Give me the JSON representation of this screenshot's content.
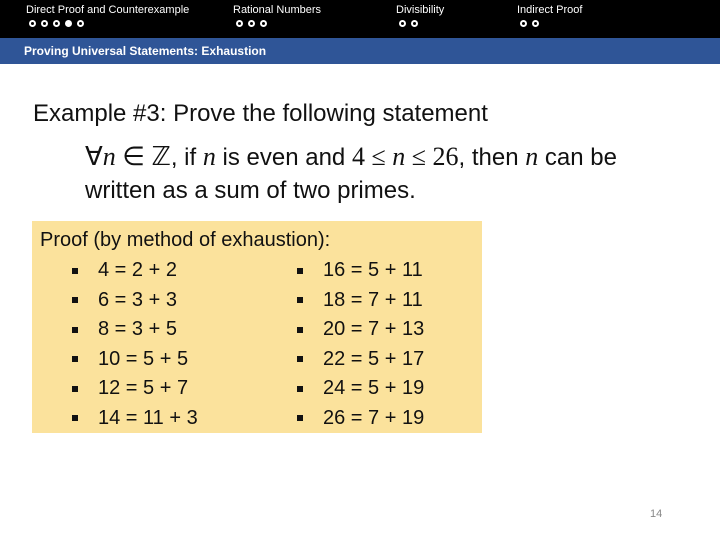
{
  "nav": {
    "sections": [
      {
        "title": "Direct Proof and Counterexample",
        "dots": 5,
        "active_dot": 4
      },
      {
        "title": "Rational Numbers",
        "dots": 3,
        "active_dot": 0
      },
      {
        "title": "Divisibility",
        "dots": 2,
        "active_dot": 0
      },
      {
        "title": "Indirect Proof",
        "dots": 2,
        "active_dot": 0
      }
    ]
  },
  "subtitle": "Proving Universal Statements: Exhaustion",
  "slide": {
    "heading": "Example #3: Prove the following statement",
    "statement": {
      "forall": "∀",
      "var": "n",
      "in": " ∈ ",
      "set": "ℤ",
      "part1": ", if ",
      "part2": " is even and ",
      "bound_low": "4 ≤ ",
      "bound_high": " ≤ 26",
      "part3": ", then ",
      "part4": " can be written as a sum of two primes."
    },
    "proof": {
      "title": "Proof (by method of exhaustion):",
      "left": [
        "4 = 2 + 2",
        "6 = 3 + 3",
        "8 = 3 + 5",
        "10 = 5 + 5",
        "12 = 5 + 7",
        "14 = 11 + 3"
      ],
      "right": [
        "16 = 5 + 11",
        "18 = 7 + 11",
        "20 = 7 + 13",
        "22 = 5 + 17",
        "24 = 5 + 19",
        "26 = 7 + 19"
      ]
    }
  },
  "page_number": "14"
}
